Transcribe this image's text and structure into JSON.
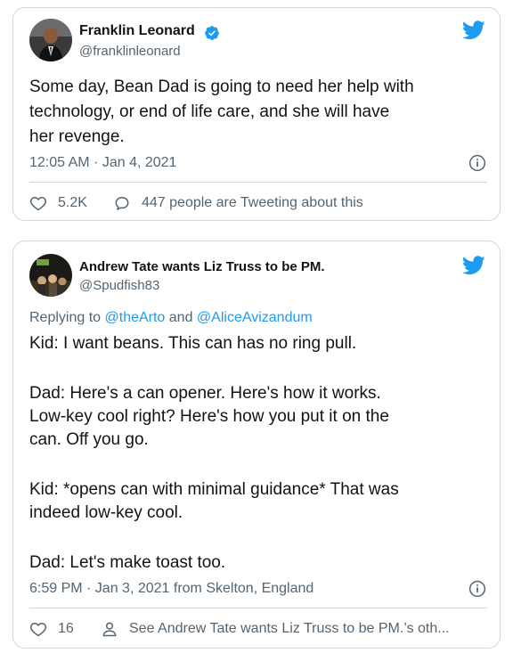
{
  "tweet1": {
    "author_name": "Franklin Leonard",
    "author_handle": "@franklinleonard",
    "verified": true,
    "text_lines": [
      "Some day, Bean Dad is going to need her help with",
      "technology, or end of life care, and she will have",
      "her revenge."
    ],
    "timestamp": "12:05 AM · Jan 4, 2021",
    "like_count": "5.2K",
    "conversation_text": "447 people are Tweeting about this"
  },
  "tweet2": {
    "author_name": "Andrew Tate wants Liz Truss to be PM.",
    "author_handle": "@Spudfish83",
    "replying_prefix": "Replying to ",
    "replying_user1": "@theArto",
    "replying_and": " and ",
    "replying_user2": "@AliceAvizandum",
    "text_lines": [
      "Kid: I want beans. This can has no ring pull.",
      "Dad: Here's a can opener. Here's how it works.",
      "Low-key cool right? Here's how you put it on the",
      "can. Off you go.",
      "Kid: *opens can with minimal guidance* That was",
      "indeed low-key cool.",
      "Dad: Let's make toast too."
    ],
    "timestamp": "6:59 PM · Jan 3, 2021 from Skelton, England",
    "like_count": "16",
    "profile_link_text": "See Andrew Tate wants Liz Truss to be PM.’s oth..."
  },
  "colors": {
    "brand_blue": "#1d9bf0",
    "text_primary": "#0f1419",
    "text_secondary": "#536471",
    "border": "#cfd9de"
  },
  "icons": [
    "twitter-bird-icon",
    "verified-badge-icon",
    "info-icon",
    "heart-icon",
    "speech-bubble-icon",
    "person-icon"
  ]
}
